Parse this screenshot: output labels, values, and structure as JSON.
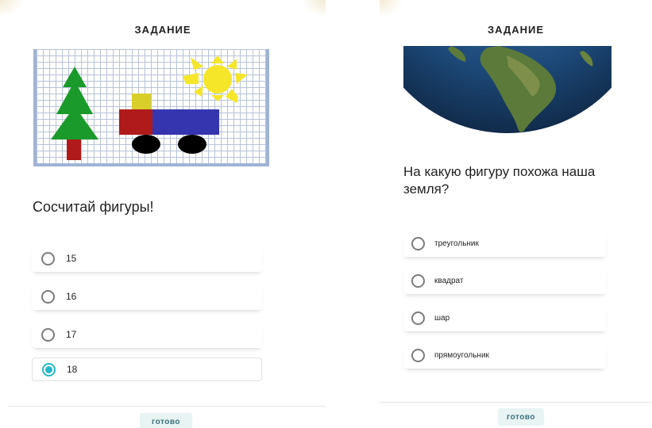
{
  "left_screen": {
    "header_title": "ЗАДАНИЕ",
    "question": "Сосчитай фигуры!",
    "options": [
      {
        "label": "15",
        "selected": false
      },
      {
        "label": "16",
        "selected": false
      },
      {
        "label": "17",
        "selected": false
      },
      {
        "label": "18",
        "selected": true
      }
    ],
    "done_label": "готово"
  },
  "right_screen": {
    "header_title": "ЗАДАНИЕ",
    "question": "На какую фигуру похожа наша земля?",
    "options": [
      {
        "label": "треугольник",
        "selected": false
      },
      {
        "label": "квадрат",
        "selected": false
      },
      {
        "label": "шар",
        "selected": false
      },
      {
        "label": "прямоугольник",
        "selected": false
      }
    ],
    "done_label": "готово"
  },
  "colors": {
    "accent": "#27b8c7",
    "tree_green": "#1a9a2a",
    "trunk_red": "#b01a1a",
    "sun_yellow": "#f5e62a",
    "truck_blue": "#3535b0",
    "truck_red": "#b01a1a",
    "cabin_yellow": "#d8cf2a",
    "wheel_black": "#000000"
  },
  "icons": {
    "picture": "shapes-picture-tree-truck-sun",
    "globe": "earth-globe-image"
  }
}
